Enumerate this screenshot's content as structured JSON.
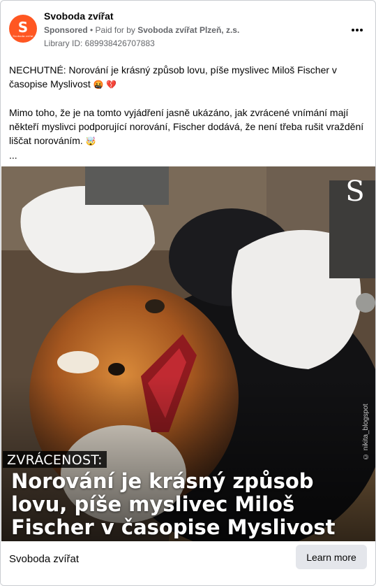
{
  "header": {
    "avatar_letter": "S",
    "avatar_text": "Svoboda zvířat",
    "page_name": "Svoboda zvířat",
    "sponsored": "Sponsored",
    "paid_prefix": " • Paid for by ",
    "paid_by": "Svoboda zvířat Plzeň, z.s.",
    "library_id": "Library ID: 689938426707883",
    "more_icon": "three-dots-icon"
  },
  "post": {
    "line1": "NECHUTNÉ: Norování je krásný způsob lovu, píše myslivec Miloš Fischer v časopise Myslivost",
    "line1_emoji": " 🤬 💔",
    "line2": "Mimo toho, že je na tomto vyjádření jasně ukázáno, jak zvrácené vnímání mají někteří myslivci podporující norování, Fischer dodává, že není třeba rušit vraždění liščat norováním.",
    "line2_emoji": " 🤯",
    "ellipsis": "..."
  },
  "media": {
    "badge_letter": "S",
    "watermark": "© nikita_blogspot",
    "tag": "ZVRÁCENOST:",
    "headline": "Norování je krásný způsob lovu, píše myslivec Miloš Fischer v časopise Myslivost"
  },
  "footer": {
    "name": "Svoboda zvířat",
    "cta": "Learn more"
  },
  "colors": {
    "avatar": "#ff5722",
    "cta_bg": "#e4e6eb",
    "meta": "#65676b"
  }
}
